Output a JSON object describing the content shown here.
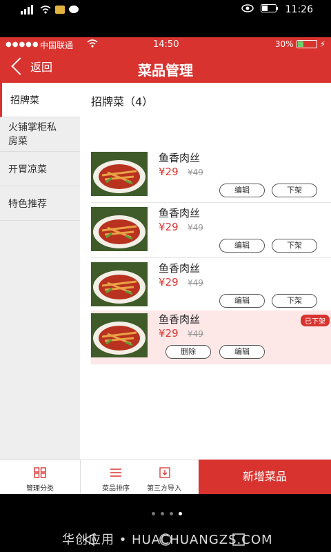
{
  "system": {
    "time": "11:26"
  },
  "status": {
    "carrier": "中国联通",
    "time": "14:50",
    "battery": "30%",
    "battery_level": 0.3
  },
  "header": {
    "back_label": "返回",
    "title": "菜品管理"
  },
  "sidebar": {
    "items": [
      {
        "label": "招牌菜",
        "active": true
      },
      {
        "label": "火铺掌柜私房菜",
        "active": false
      },
      {
        "label": "开胃凉菜",
        "active": false
      },
      {
        "label": "特色推荐",
        "active": false
      }
    ]
  },
  "section": {
    "title": "招牌菜（4）"
  },
  "dishes": [
    {
      "name": "鱼香肉丝",
      "price": "¥29",
      "old_price": "¥49",
      "btn1": "编辑",
      "btn2": "下架"
    },
    {
      "name": "鱼香肉丝",
      "price": "¥29",
      "old_price": "¥49",
      "btn1": "编辑",
      "btn2": "下架"
    },
    {
      "name": "鱼香肉丝",
      "price": "¥29",
      "old_price": "¥49",
      "btn1": "编辑",
      "btn2": "下架"
    },
    {
      "name": "鱼香肉丝",
      "price": "¥29",
      "old_price": "¥49",
      "btn1": "删除",
      "btn2": "编辑",
      "badge": "已下架"
    }
  ],
  "tabbar": {
    "manage": "管理分类",
    "sort": "菜品排序",
    "import": "第三方导入",
    "add": "新增菜品"
  },
  "watermark": "华创应用 • HUACHUANGZS.COM",
  "colors": {
    "accent": "#d8332f",
    "offline_bg": "#fde7e7"
  }
}
